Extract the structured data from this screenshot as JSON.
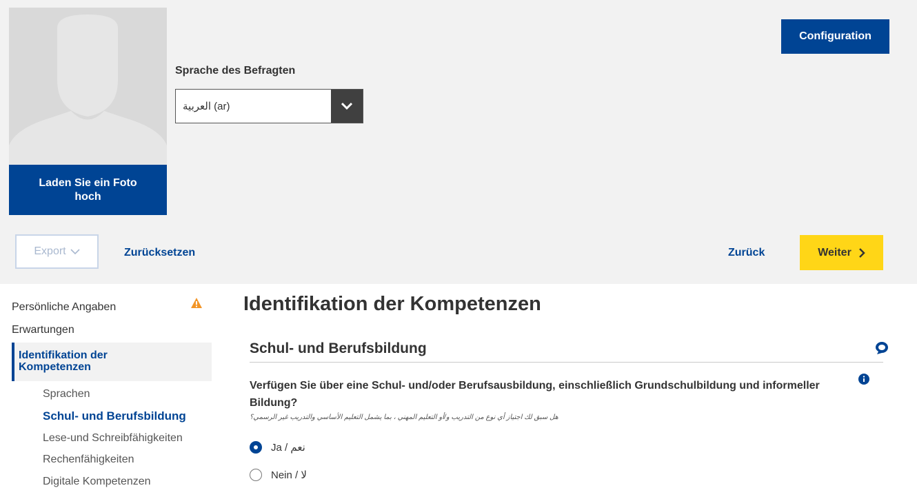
{
  "header": {
    "upload_photo_label": "Laden Sie ein Foto hoch",
    "language_label": "Sprache des Befragten",
    "language_selected": "العربية (ar)",
    "configuration_label": "Configuration"
  },
  "toolbar": {
    "export_label": "Export",
    "reset_label": "Zurücksetzen",
    "back_label": "Zurück",
    "next_label": "Weiter"
  },
  "sidebar": {
    "items": [
      {
        "label": "Persönliche Angaben",
        "warning": true
      },
      {
        "label": "Erwartungen"
      },
      {
        "label": "Identifikation der Kompetenzen",
        "active": true
      }
    ],
    "subitems": [
      {
        "label": "Sprachen"
      },
      {
        "label": "Schul- und Berufsbildung",
        "active": true
      },
      {
        "label": "Lese-und Schreibfähigkeiten"
      },
      {
        "label": "Rechenfähigkeiten"
      },
      {
        "label": "Digitale Kompetenzen"
      }
    ]
  },
  "main": {
    "title": "Identifikation der Kompetenzen",
    "section_title": "Schul- und Berufsbildung",
    "question": "Verfügen Sie über eine Schul- und/oder Berufsausbildung, einschließlich Grundschulbildung und informeller Bildung?",
    "question_translation": "هل سبق لك اجتياز أي نوع من التدريب و/أو التعليم المهني ، بما يشمل التعليم الأساسي والتدريب غير الرسمي؟",
    "options": [
      {
        "label": "Ja / نعم",
        "selected": true
      },
      {
        "label": "Nein / لا",
        "selected": false
      }
    ]
  },
  "colors": {
    "primary_blue": "#004494",
    "accent_yellow": "#ffd617",
    "warning_orange": "#f29527",
    "panel_gray": "#f2f2f2"
  }
}
